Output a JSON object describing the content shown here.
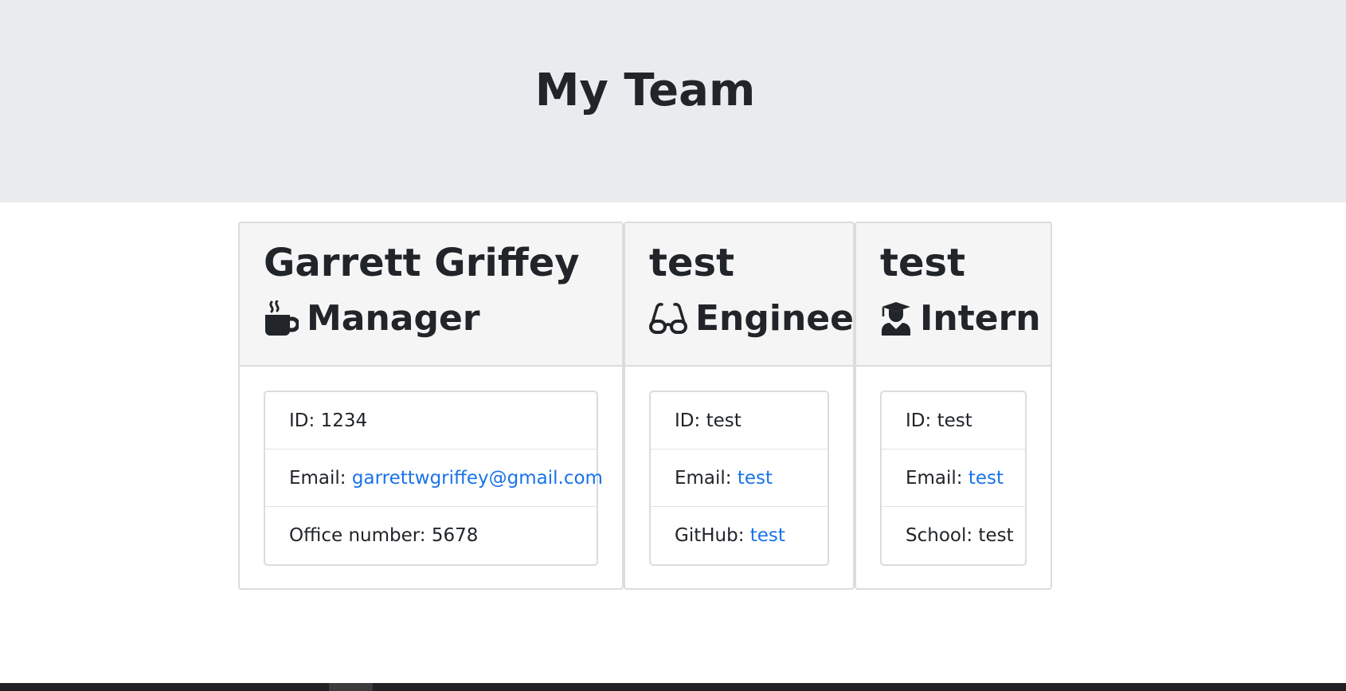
{
  "header": {
    "title": "My Team"
  },
  "cards": [
    {
      "name": "Garrett Griffey",
      "role": "Manager",
      "role_icon": "mug-icon",
      "id_label": "ID: ",
      "id_value": "1234",
      "email_label": "Email: ",
      "email_value": "garrettwgriffey@gmail.com",
      "extra_label": "Office number: ",
      "extra_value": "5678"
    },
    {
      "name": "test",
      "role": "Engineer",
      "role_icon": "glasses-icon",
      "id_label": "ID: ",
      "id_value": "test",
      "email_label": "Email: ",
      "email_value": "test",
      "extra_label": "GitHub: ",
      "extra_value": "test"
    },
    {
      "name": "test",
      "role": "Intern",
      "role_icon": "graduate-icon",
      "id_label": "ID: ",
      "id_value": "test",
      "email_label": "Email: ",
      "email_value": "test",
      "extra_label": "School: ",
      "extra_value": "test"
    }
  ],
  "colors": {
    "jumbotron_bg": "#e9ecef",
    "card_header_bg": "#f5f5f5",
    "link": "#1a73e8",
    "text": "#212529"
  }
}
